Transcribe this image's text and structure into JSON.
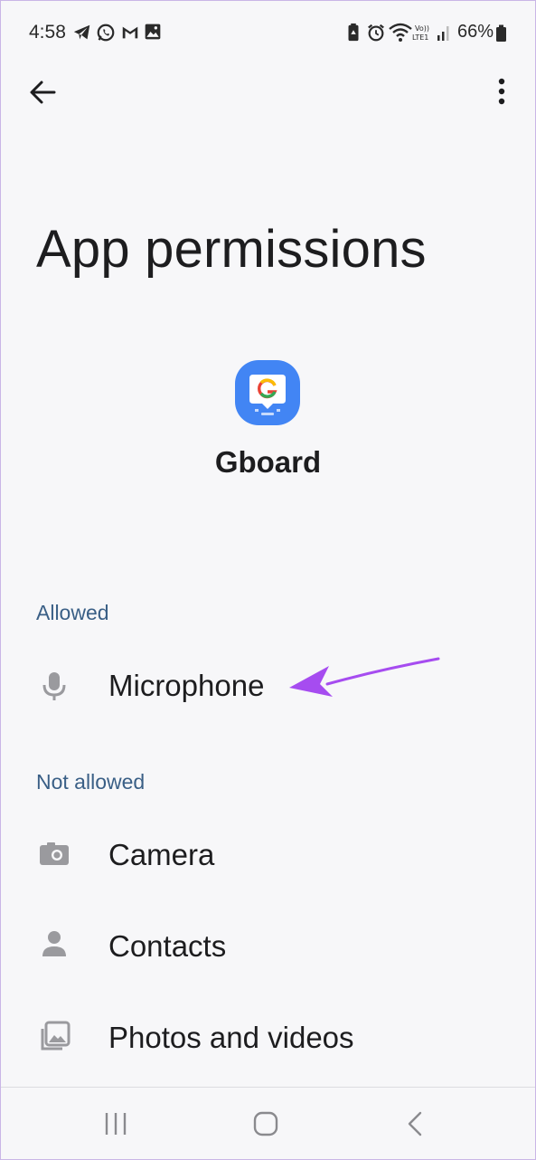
{
  "status_bar": {
    "time": "4:58",
    "battery": "66%",
    "icons": [
      "telegram-icon",
      "whatsapp-icon",
      "gmail-icon",
      "gallery-icon",
      "battery-saver-icon",
      "alarm-icon",
      "wifi-icon",
      "volte-icon",
      "signal-icon",
      "battery-icon"
    ]
  },
  "toolbar": {
    "back_icon": "arrow-left-icon",
    "more_icon": "more-vert-icon"
  },
  "page": {
    "title": "App permissions",
    "app_name": "Gboard"
  },
  "sections": {
    "allowed": {
      "header": "Allowed",
      "items": [
        {
          "label": "Microphone",
          "icon": "microphone-icon"
        }
      ]
    },
    "not_allowed": {
      "header": "Not allowed",
      "items": [
        {
          "label": "Camera",
          "icon": "camera-icon"
        },
        {
          "label": "Contacts",
          "icon": "person-icon"
        },
        {
          "label": "Photos and videos",
          "icon": "photos-icon"
        }
      ]
    }
  },
  "annotation": {
    "arrow_color": "#a64cf0"
  },
  "colors": {
    "section_header": "#3a5f86",
    "icon_gray": "#9a9a9e",
    "gboard_blue": "#4285f4"
  },
  "nav_bar": {
    "icons": [
      "recents-icon",
      "home-icon",
      "back-icon"
    ]
  }
}
